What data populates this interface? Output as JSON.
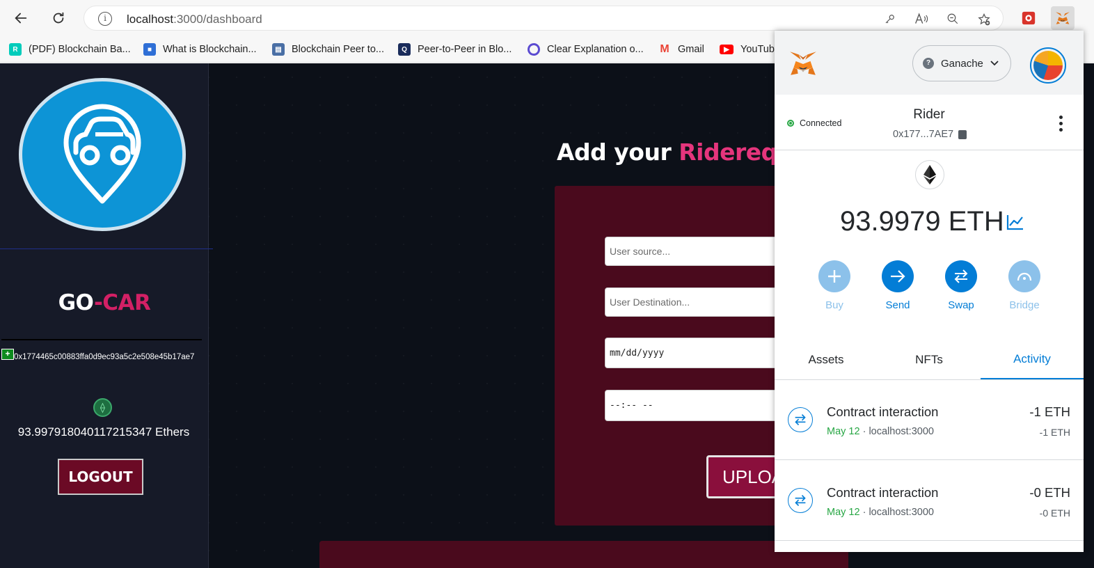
{
  "browser": {
    "url_host": "localhost",
    "url_path": ":3000/dashboard",
    "bookmarks": [
      {
        "label": "(PDF) Blockchain Ba...",
        "icon": "researchgate-icon",
        "color": "#00ccbb"
      },
      {
        "label": "What is Blockchain...",
        "icon": "cube-icon",
        "color": "#2f6fd6"
      },
      {
        "label": "Blockchain Peer to...",
        "icon": "page-icon",
        "color": "#4a6fa5"
      },
      {
        "label": "Peer-to-Peer in Blo...",
        "icon": "q-icon",
        "color": "#1a2c5b"
      },
      {
        "label": "Clear Explanation o...",
        "icon": "ring-icon",
        "color": "#5b4bd1"
      },
      {
        "label": "Gmail",
        "icon": "gmail-icon",
        "color": "#ea4335"
      },
      {
        "label": "YouTub",
        "icon": "youtube-icon",
        "color": "#ff0000"
      }
    ]
  },
  "sidebar": {
    "brand_main": "GO",
    "brand_accent": "-CAR",
    "address": "0x1774465c00883ffa0d9ec93a5c2e508e45b17ae7",
    "balance": "93.997918040117215347 Ethers",
    "logout": "LOGOUT"
  },
  "main": {
    "heading_prefix": "Add your ",
    "heading_accent": "Riderequest",
    "fields": {
      "source_placeholder": "User source...",
      "destination_placeholder": "User Destination...",
      "date_placeholder": "mm/dd/yyyy",
      "time_placeholder": "--:-- --"
    },
    "upload": "UPLOAD"
  },
  "metamask": {
    "network": "Ganache",
    "status": "Connected",
    "account_name": "Rider",
    "account_address": "0x177...7AE7",
    "balance": "93.9979 ETH",
    "actions": [
      {
        "label": "Buy",
        "enabled": false
      },
      {
        "label": "Send",
        "enabled": true
      },
      {
        "label": "Swap",
        "enabled": true
      },
      {
        "label": "Bridge",
        "enabled": false
      }
    ],
    "tabs": [
      "Assets",
      "NFTs",
      "Activity"
    ],
    "active_tab": "Activity",
    "transactions": [
      {
        "title": "Contract interaction",
        "date": "May 12",
        "origin": "localhost:3000",
        "amount": "-1 ETH",
        "amount_secondary": "-1 ETH"
      },
      {
        "title": "Contract interaction",
        "date": "May 12",
        "origin": "localhost:3000",
        "amount": "-0 ETH",
        "amount_secondary": "-0 ETH"
      }
    ],
    "accent_color": "#037dd6"
  }
}
